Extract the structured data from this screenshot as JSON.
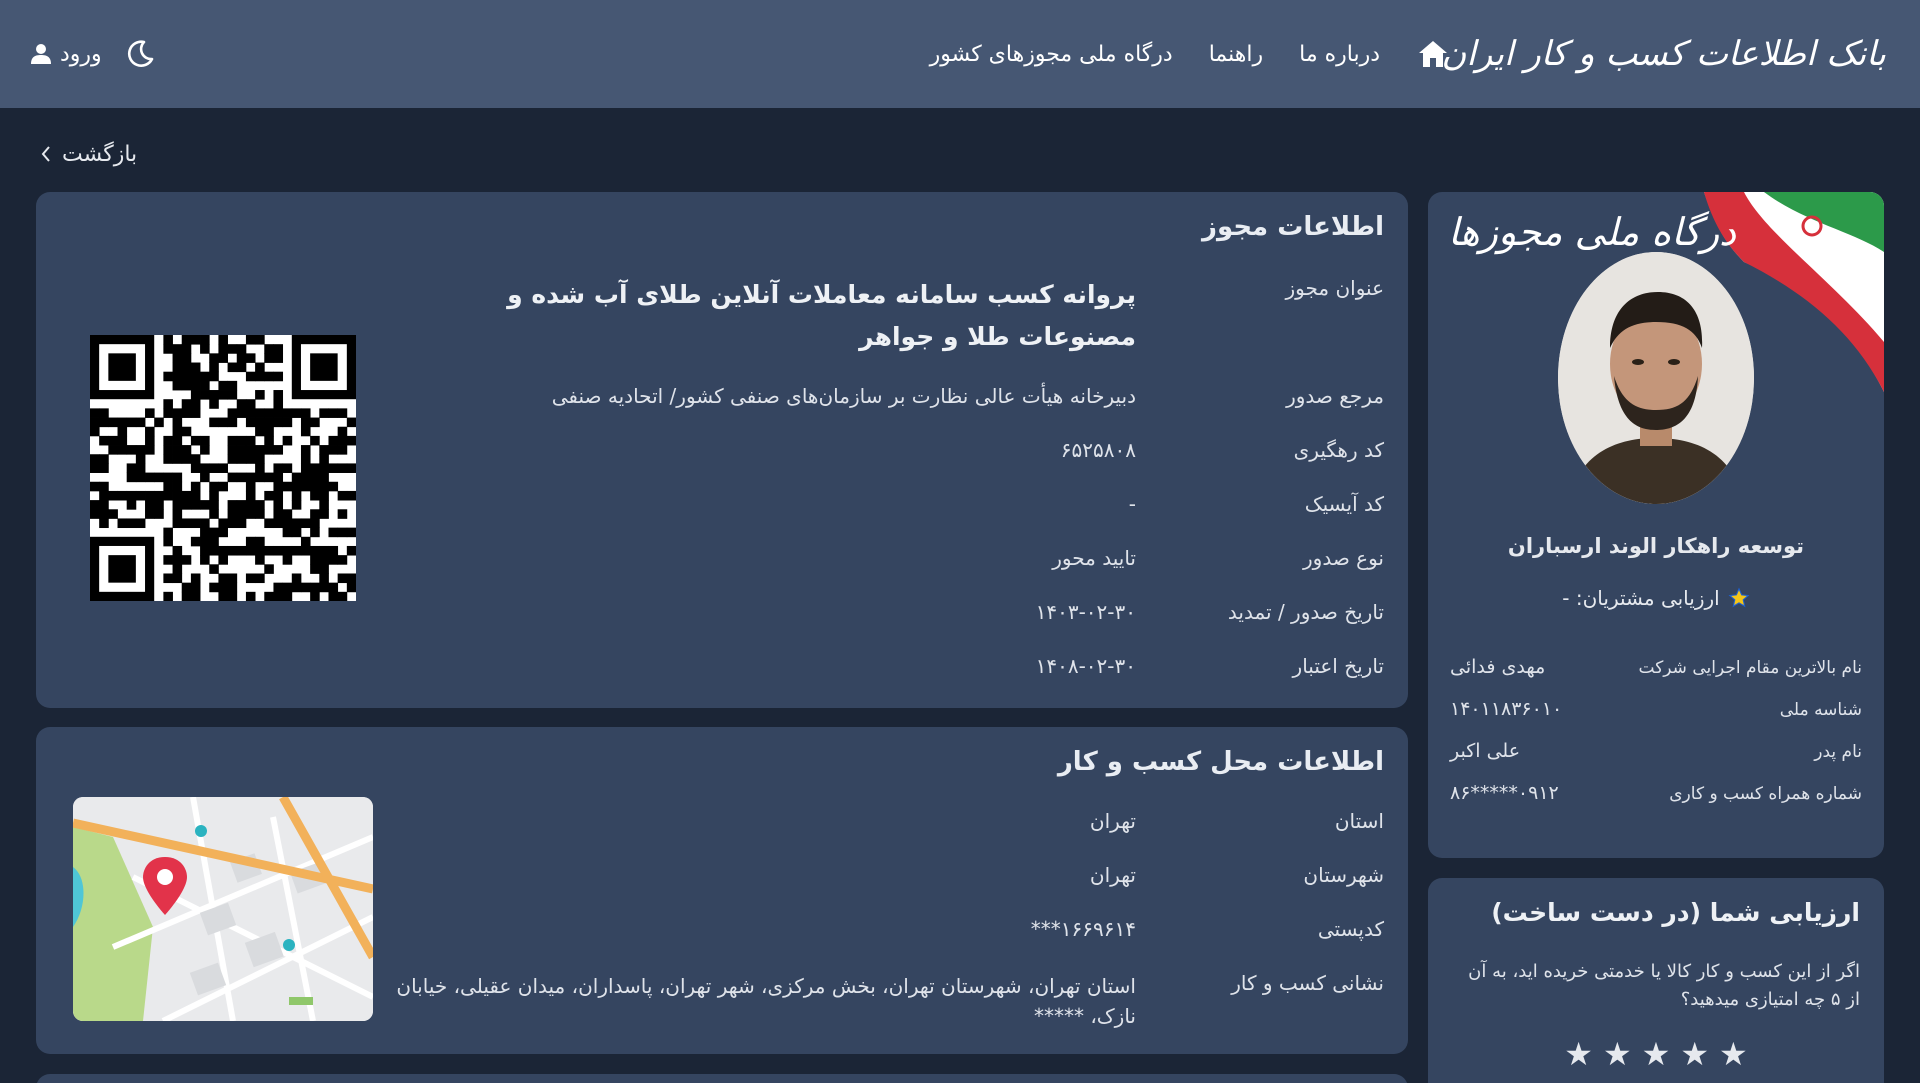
{
  "header": {
    "brand": "بانک اطلاعات کسب و کار ایران",
    "nav": {
      "home_icon": "home-icon",
      "about": "درباره ما",
      "guide": "راهنما",
      "portal": "درگاه ملی مجوزهای کشور"
    },
    "login_label": "ورود",
    "user_icon": "user-icon",
    "theme_icon": "moon-icon"
  },
  "back_label": "بازگشت",
  "license": {
    "section_title": "اطلاعات مجوز",
    "rows": [
      {
        "label": "عنوان مجوز",
        "value": "پروانه کسب سامانه معاملات آنلاین طلای آب شده و مصنوعات طلا و جواهر"
      },
      {
        "label": "مرجع صدور",
        "value": "دبیرخانه هیأت عالی نظارت بر سازمان‌های صنفی کشور/ اتحادیه صنفی"
      },
      {
        "label": "کد رهگیری",
        "value": "۶۵۲۵۸۰۸"
      },
      {
        "label": "کد آیسیک",
        "value": "-"
      },
      {
        "label": "نوع صدور",
        "value": "تایید محور"
      },
      {
        "label": "تاریخ صدور / تمدید",
        "value": "۱۴۰۳-۰۲-۳۰"
      },
      {
        "label": "تاریخ اعتبار",
        "value": "۱۴۰۸-۰۲-۳۰"
      }
    ]
  },
  "location": {
    "section_title": "اطلاعات محل کسب و کار",
    "rows": [
      {
        "label": "استان",
        "value": "تهران"
      },
      {
        "label": "شهرستان",
        "value": "تهران"
      },
      {
        "label": "کدپستی",
        "value": "۱۶۶۹۶۱۴***"
      },
      {
        "label": "نشانی کسب و کار",
        "value": "استان تهران، شهرستان تهران، بخش مرکزی، شهر تهران، پاسداران، میدان عقیلی، خیابان نازک، *****"
      }
    ]
  },
  "profile": {
    "portal_logo": "درگاه ملی مجوزها",
    "company_name": "توسعه راهکار الوند ارسباران",
    "customer_rating_label": "ارزیابی مشتریان: -",
    "rows": [
      {
        "label": "نام بالاترین مقام اجرایی شرکت",
        "value": "مهدی فدائی"
      },
      {
        "label": "شناسه ملی",
        "value": "۱۴۰۱۱۸۳۶۰۱۰"
      },
      {
        "label": "نام پدر",
        "value": "علی اکبر"
      },
      {
        "label": "شماره همراه کسب و کاری",
        "value": "۰۹۱۲*****۸۶"
      }
    ]
  },
  "rating": {
    "title": "ارزیابی شما (در دست ساخت)",
    "description": "اگر از این کسب و کار کالا یا خدمتی خریده اید، به آن از ۵ چه امتیازی میدهید؟",
    "star_glyph": "★",
    "colors": {
      "star_badge": "#f5c518"
    }
  },
  "colors": {
    "background": "#1b2536",
    "header": "#465773",
    "card": "#354560"
  }
}
